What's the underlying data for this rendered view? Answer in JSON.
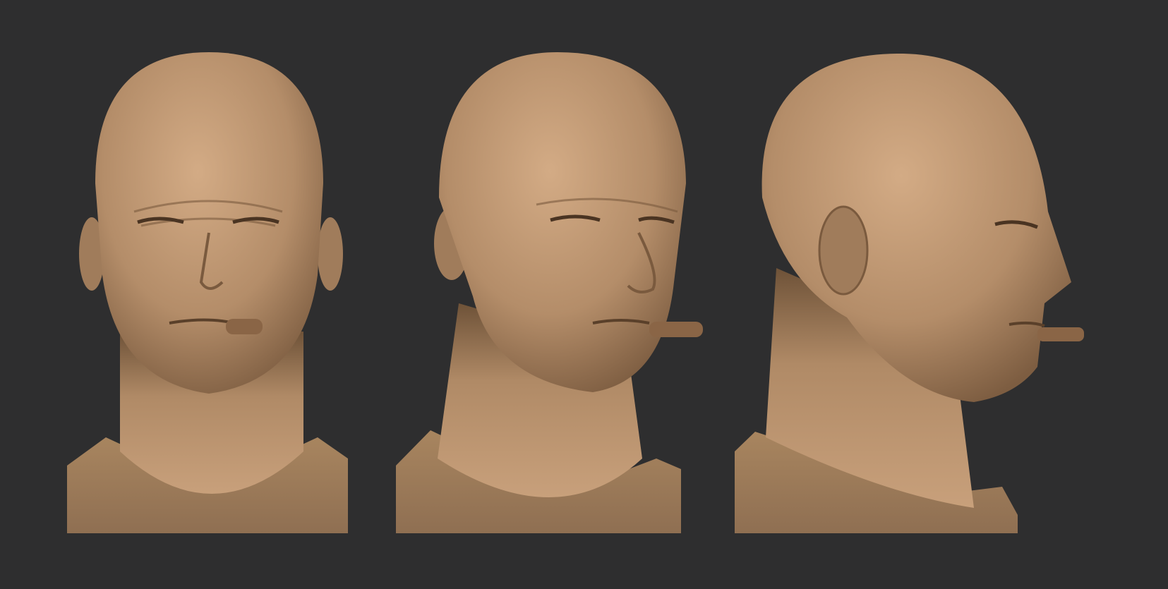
{
  "colors": {
    "background": "#2e2e2f",
    "skin_light": "#c9a07a",
    "skin_mid": "#a98462",
    "skin_dark": "#6e5238",
    "shirt": "#9c7b5c",
    "cigar": "#8a6546"
  },
  "views": [
    {
      "name": "front"
    },
    {
      "name": "three-quarter"
    },
    {
      "name": "profile"
    }
  ]
}
